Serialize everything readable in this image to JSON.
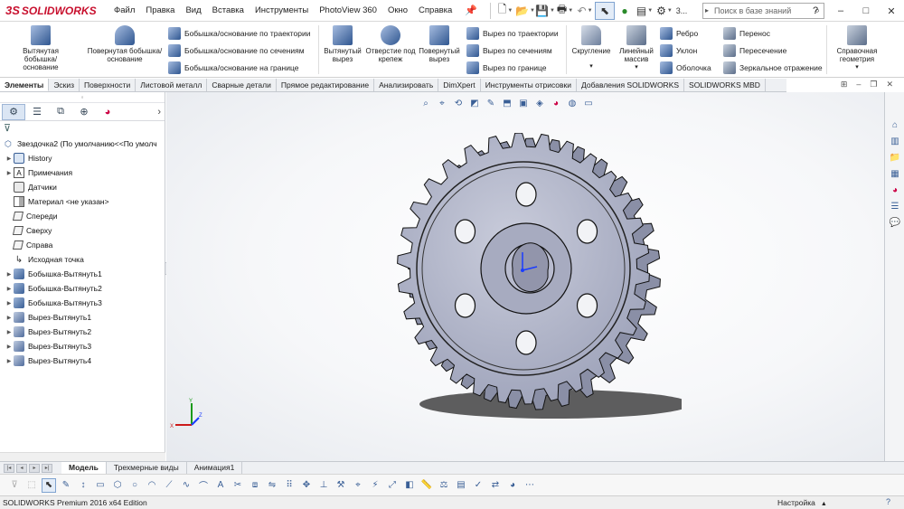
{
  "app": {
    "logo_prefix": "3S",
    "logo_text": "SOLIDWORKS"
  },
  "menu": {
    "items": [
      "Файл",
      "Правка",
      "Вид",
      "Вставка",
      "Инструменты",
      "PhotoView 360",
      "Окно",
      "Справка"
    ]
  },
  "quick_access": {
    "overflow_label": "3..."
  },
  "search": {
    "placeholder": "Поиск в базе знаний"
  },
  "ribbon": {
    "extrude_boss": "Вытянутая бобышка/основание",
    "revolve_boss": "Повернутая бобышка/основание",
    "sweep_boss": "Бобышка/основание по траектории",
    "loft_boss": "Бобышка/основание по сечениям",
    "boundary_boss": "Бобышка/основание на границе",
    "extrude_cut": "Вытянутый вырез",
    "hole_wizard": "Отверстие под крепеж",
    "revolve_cut": "Повернутый вырез",
    "sweep_cut": "Вырез по траектории",
    "loft_cut": "Вырез по сечениям",
    "boundary_cut": "Вырез по границе",
    "fillet": "Скругление",
    "linear_pattern": "Линейный массив",
    "rib": "Ребро",
    "draft": "Уклон",
    "shell": "Оболочка",
    "wrap": "Перенос",
    "intersect": "Пересечение",
    "mirror": "Зеркальное отражение",
    "ref_geometry": "Справочная геометрия"
  },
  "cm_tabs": [
    "Элементы",
    "Эскиз",
    "Поверхности",
    "Листовой металл",
    "Сварные детали",
    "Прямое редактирование",
    "Анализировать",
    "DimXpert",
    "Инструменты отрисовки",
    "Добавления SOLIDWORKS",
    "SOLIDWORKS MBD"
  ],
  "tree": {
    "root": "Звездочка2 (По умолчанию<<По умолч",
    "items": [
      {
        "label": "History",
        "icon": "history-icon",
        "expandable": true
      },
      {
        "label": "Примечания",
        "icon": "annotations-icon",
        "expandable": true
      },
      {
        "label": "Датчики",
        "icon": "sensors-icon",
        "expandable": false
      },
      {
        "label": "Материал <не указан>",
        "icon": "material-icon",
        "expandable": false
      },
      {
        "label": "Спереди",
        "icon": "plane-icon",
        "expandable": false
      },
      {
        "label": "Сверху",
        "icon": "plane-icon",
        "expandable": false
      },
      {
        "label": "Справа",
        "icon": "plane-icon",
        "expandable": false
      },
      {
        "label": "Исходная точка",
        "icon": "origin-icon",
        "expandable": false
      },
      {
        "label": "Бобышка-Вытянуть1",
        "icon": "extrude-feature-icon",
        "expandable": true
      },
      {
        "label": "Бобышка-Вытянуть2",
        "icon": "extrude-feature-icon",
        "expandable": true
      },
      {
        "label": "Бобышка-Вытянуть3",
        "icon": "extrude-feature-icon",
        "expandable": true
      },
      {
        "label": "Вырез-Вытянуть1",
        "icon": "cut-feature-icon",
        "expandable": true
      },
      {
        "label": "Вырез-Вытянуть2",
        "icon": "cut-feature-icon",
        "expandable": true
      },
      {
        "label": "Вырез-Вытянуть3",
        "icon": "cut-feature-icon",
        "expandable": true
      },
      {
        "label": "Вырез-Вытянуть4",
        "icon": "cut-feature-icon",
        "expandable": true
      }
    ]
  },
  "bottom_tabs": [
    "Модель",
    "Трехмерные виды",
    "Анимация1"
  ],
  "status": {
    "left": "SOLIDWORKS Premium 2016 x64 Edition",
    "right": "Настройка"
  },
  "model": {
    "teeth": 30,
    "holes": 6,
    "body_color": "#b4b8cc",
    "accent": "#c8102e"
  }
}
